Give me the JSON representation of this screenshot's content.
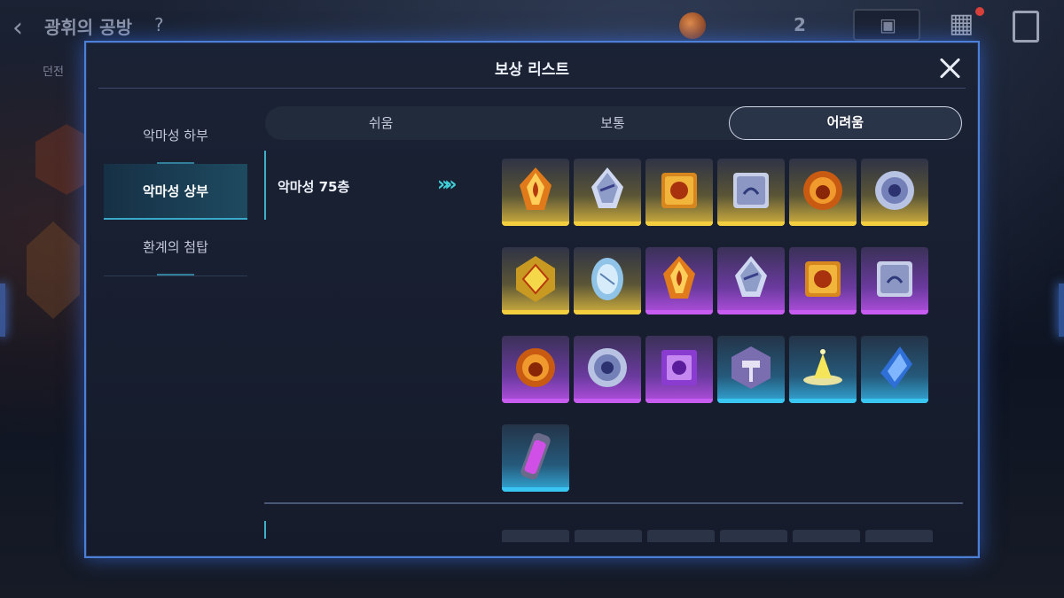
{
  "background": {
    "title": "광휘의 공방",
    "help": "?",
    "sub_label": "던전",
    "currency_count": "2"
  },
  "modal": {
    "title": "보상 리스트",
    "close_icon": "close-icon"
  },
  "sidebar": {
    "items": [
      {
        "label": "악마성 하부",
        "active": false
      },
      {
        "label": "악마성 상부",
        "active": true
      },
      {
        "label": "환계의 첨탑",
        "active": false
      }
    ]
  },
  "tabs": [
    {
      "label": "쉬움",
      "active": false
    },
    {
      "label": "보통",
      "active": false
    },
    {
      "label": "어려움",
      "active": true
    }
  ],
  "floor": {
    "label": "악마성 75층",
    "arrow_icon": "double-chevron-right-icon"
  },
  "rewards": [
    {
      "icon": "fire-crystal-icon",
      "rarity": "gold"
    },
    {
      "icon": "ice-crystal-icon",
      "rarity": "gold"
    },
    {
      "icon": "fire-cube-icon",
      "rarity": "gold"
    },
    {
      "icon": "ice-cube-icon",
      "rarity": "gold"
    },
    {
      "icon": "fire-orb-icon",
      "rarity": "gold"
    },
    {
      "icon": "ice-orb-icon",
      "rarity": "gold"
    },
    {
      "icon": "gold-polyhedron-icon",
      "rarity": "gold"
    },
    {
      "icon": "crystal-disc-icon",
      "rarity": "gold"
    },
    {
      "icon": "fire-crystal-icon",
      "rarity": "purple"
    },
    {
      "icon": "ice-crystal-icon",
      "rarity": "purple"
    },
    {
      "icon": "fire-cube-icon",
      "rarity": "purple"
    },
    {
      "icon": "ice-cube-icon",
      "rarity": "purple"
    },
    {
      "icon": "fire-orb-icon",
      "rarity": "purple"
    },
    {
      "icon": "ice-orb-icon",
      "rarity": "purple"
    },
    {
      "icon": "purple-box-icon",
      "rarity": "purple"
    },
    {
      "icon": "hammer-badge-icon",
      "rarity": "blue"
    },
    {
      "icon": "gold-dust-icon",
      "rarity": "blue"
    },
    {
      "icon": "blue-shard-icon",
      "rarity": "blue"
    },
    {
      "icon": "purple-vial-icon",
      "rarity": "blue"
    }
  ],
  "colors": {
    "modal_border": "#4c7fd6",
    "accent_cyan": "#3fb0c8",
    "rarity_gold": "#f3cf3f",
    "rarity_purple": "#c65cf0",
    "rarity_blue": "#3ac6f2"
  }
}
